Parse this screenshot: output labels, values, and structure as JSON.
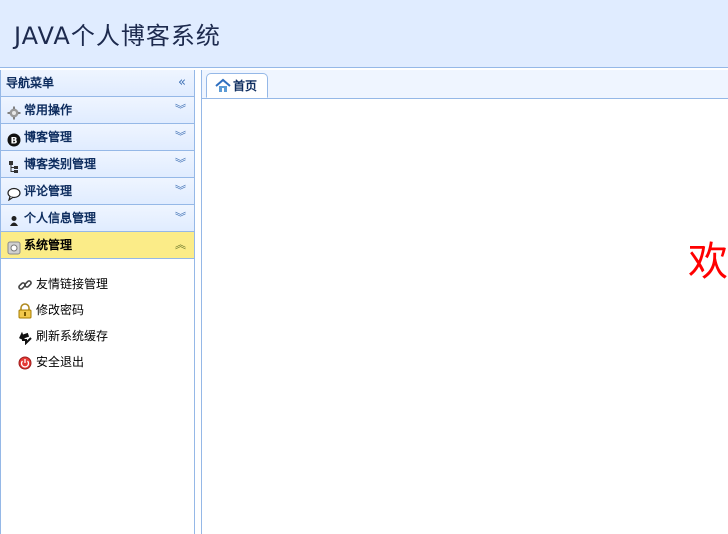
{
  "header": {
    "title": "JAVA个人博客系统"
  },
  "nav": {
    "title": "导航菜单",
    "sections": [
      {
        "label": "常用操作",
        "icon": "gear-icon",
        "expanded": false
      },
      {
        "label": "博客管理",
        "icon": "blog-icon",
        "expanded": false
      },
      {
        "label": "博客类别管理",
        "icon": "tree-icon",
        "expanded": false
      },
      {
        "label": "评论管理",
        "icon": "comment-icon",
        "expanded": false
      },
      {
        "label": "个人信息管理",
        "icon": "user-icon",
        "expanded": false
      },
      {
        "label": "系统管理",
        "icon": "system-icon",
        "expanded": true,
        "items": [
          {
            "label": "友情链接管理",
            "icon": "link-icon"
          },
          {
            "label": "修改密码",
            "icon": "lock-icon"
          },
          {
            "label": "刷新系统缓存",
            "icon": "refresh-icon"
          },
          {
            "label": "安全退出",
            "icon": "exit-icon"
          }
        ]
      }
    ]
  },
  "tabs": [
    {
      "label": "首页",
      "icon": "home-icon",
      "active": true
    }
  ],
  "content": {
    "welcome_text": "欢"
  },
  "colors": {
    "accent": "#95b8e7",
    "header_bg": "#e0ecff",
    "selected": "#fbec88",
    "welcome": "#ff0000"
  }
}
